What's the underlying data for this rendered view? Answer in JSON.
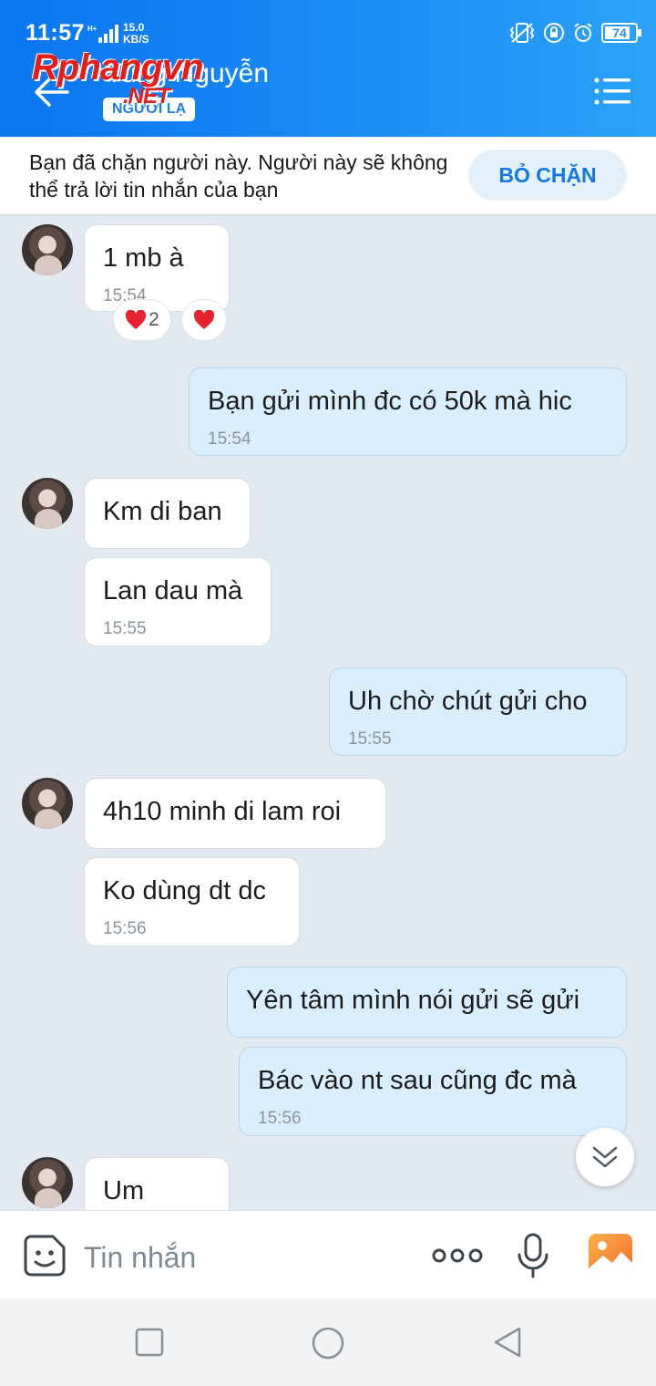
{
  "status_bar": {
    "time": "11:57",
    "network": "H+",
    "speed_value": "15.0",
    "speed_unit": "KB/S",
    "battery": "74"
  },
  "header": {
    "contact_name": "Tung Nguyễn",
    "tag": "NGƯỜI LẠ",
    "watermark": "Rphangvn",
    "watermark_sub": ".NET"
  },
  "blocked_banner": {
    "text": "Bạn đã chặn người này. Người này sẽ không thể trả lời tin nhắn của bạn",
    "button": "BỎ CHẶN"
  },
  "messages": [
    {
      "side": "in",
      "text": "1 mb à",
      "time": "15:54"
    },
    {
      "reaction_count": "2"
    },
    {
      "side": "out",
      "text": "Bạn gửi mình đc có 50k mà hic",
      "time": "15:54"
    },
    {
      "side": "in",
      "text": "Km di ban"
    },
    {
      "side": "in",
      "text": "Lan dau mà",
      "time": "15:55"
    },
    {
      "side": "out",
      "text": "Uh chờ chút gửi cho",
      "time": "15:55"
    },
    {
      "side": "in",
      "text": "4h10 minh di lam roi"
    },
    {
      "side": "in",
      "text": "Ko dùng dt dc",
      "time": "15:56"
    },
    {
      "side": "out",
      "text": "Yên tâm mình nói gửi sẽ gửi"
    },
    {
      "side": "out",
      "text": "Bác vào nt sau cũng đc mà",
      "time": "15:56"
    },
    {
      "side": "in",
      "text": "Um"
    }
  ],
  "input": {
    "placeholder": "Tin nhắn"
  },
  "colors": {
    "header_start": "#0a76f0",
    "header_end": "#2ba3f8",
    "outgoing_bubble": "#d9efff",
    "incoming_bubble": "#ffffff",
    "chat_bg": "#e2e9f1"
  }
}
